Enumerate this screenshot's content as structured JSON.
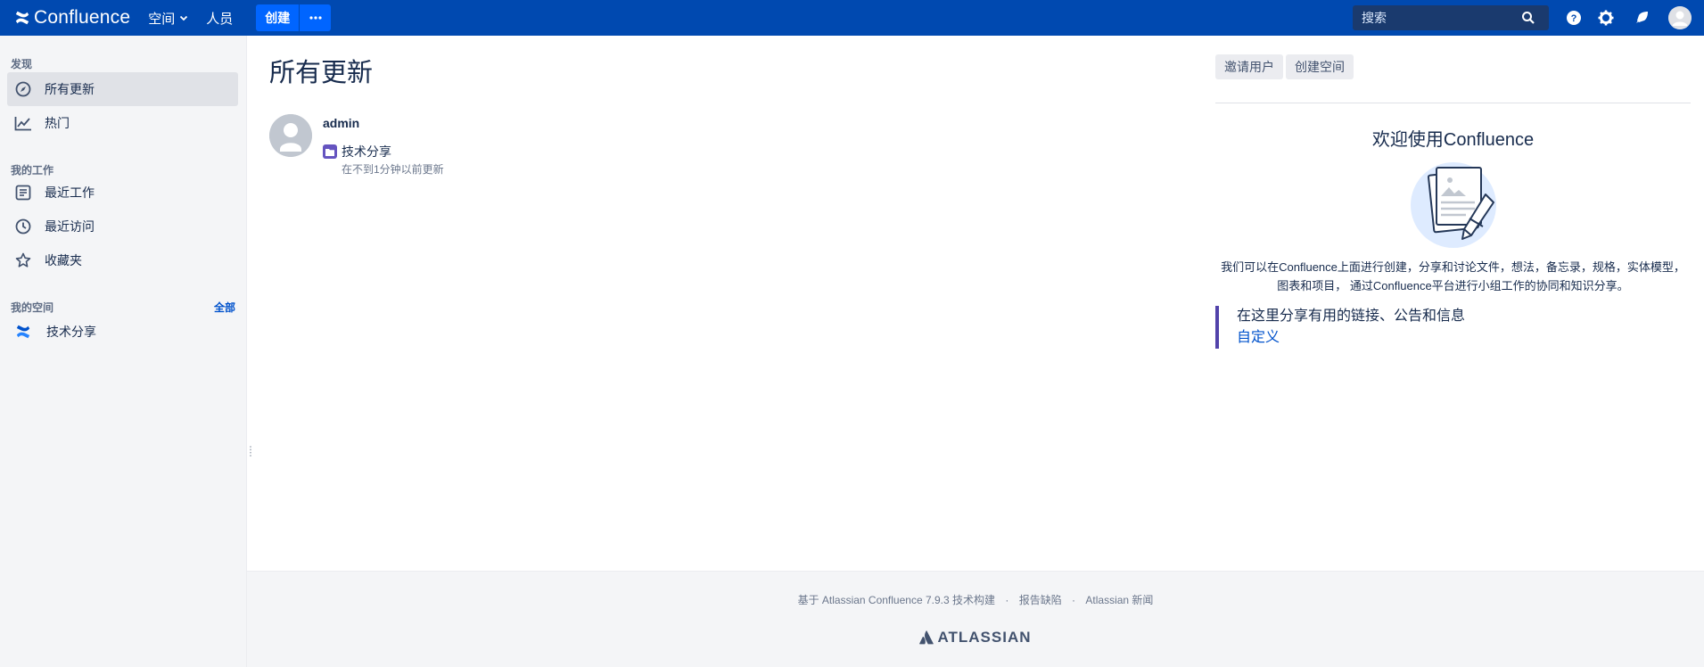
{
  "topnav": {
    "logo_text": "Confluence",
    "spaces_label": "空间",
    "people_label": "人员",
    "create_label": "创建",
    "search_placeholder": "搜索"
  },
  "sidebar": {
    "discover_title": "发现",
    "discover_items": [
      {
        "label": "所有更新",
        "icon": "compass-icon",
        "active": true
      },
      {
        "label": "热门",
        "icon": "trending-icon",
        "active": false
      }
    ],
    "mywork_title": "我的工作",
    "mywork_items": [
      {
        "label": "最近工作",
        "icon": "document-icon"
      },
      {
        "label": "最近访问",
        "icon": "clock-icon"
      },
      {
        "label": "收藏夹",
        "icon": "star-icon"
      }
    ],
    "myspaces_title": "我的空间",
    "myspaces_all_label": "全部",
    "spaces": [
      {
        "label": "技术分享",
        "icon": "confluence-space-icon"
      }
    ]
  },
  "main": {
    "title": "所有更新",
    "feed": [
      {
        "user": "admin",
        "space": "技术分享",
        "time": "在不到1分钟以前更新"
      }
    ]
  },
  "right": {
    "invite_label": "邀请用户",
    "create_space_label": "创建空间",
    "welcome_title": "欢迎使用Confluence",
    "welcome_desc": "我们可以在Confluence上面进行创建，分享和讨论文件，想法，备忘录，规格，实体模型，图表和项目，  通过Confluence平台进行小组工作的协同和知识分享。",
    "share_text": "在这里分享有用的链接、公告和信息",
    "customize_label": "自定义"
  },
  "footer": {
    "powered_by": "基于 Atlassian Confluence 7.9.3 技术构建",
    "report_bug": "报告缺陷",
    "news": "Atlassian 新闻",
    "brand": "ATLASSIAN"
  },
  "colors": {
    "nav_bg": "#0049b0",
    "create_btn": "#0065ff",
    "space_purple": "#6554c0",
    "accent_border": "#5243aa",
    "link_blue": "#0052cc"
  }
}
